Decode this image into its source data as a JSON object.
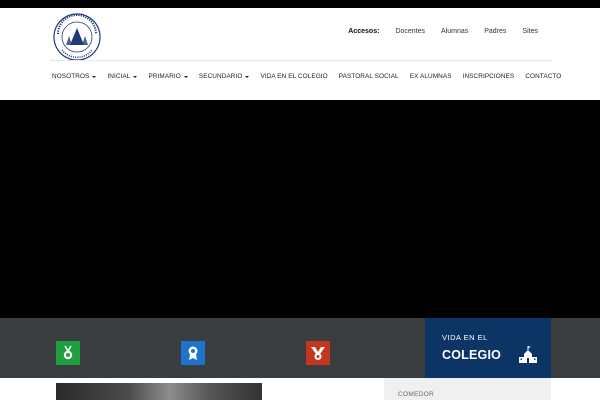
{
  "logo": {
    "text_top": "COLEGIO SAN MARTÍN DE TOURS",
    "text_bottom": "MUJERES",
    "color": "#1f3a7a"
  },
  "access": {
    "label": "Accesos:",
    "links": [
      "Docentes",
      "Alumnas",
      "Padres",
      "Sites"
    ]
  },
  "nav": {
    "items": [
      {
        "label": "NOSOTROS",
        "dropdown": true
      },
      {
        "label": "INICIAL",
        "dropdown": true
      },
      {
        "label": "PRIMARIO",
        "dropdown": true
      },
      {
        "label": "SECUNDARIO",
        "dropdown": true
      },
      {
        "label": "VIDA EN EL COLEGIO",
        "dropdown": false
      },
      {
        "label": "PASTORAL SOCIAL",
        "dropdown": false
      },
      {
        "label": "EX ALUMNAS",
        "dropdown": false
      },
      {
        "label": "INSCRIPCIONES",
        "dropdown": false
      },
      {
        "label": "CONTACTO",
        "dropdown": false
      }
    ]
  },
  "features": {
    "icons": [
      {
        "name": "medal-icon",
        "color": "#1fa040"
      },
      {
        "name": "award-icon",
        "color": "#1d73c9"
      },
      {
        "name": "ribbon-icon",
        "color": "#c3361f"
      }
    ],
    "bar_color": "#3a3d40"
  },
  "vida": {
    "line1": "VIDA EN EL",
    "line2": "COLEGIO",
    "color": "#0c3566"
  },
  "sidebar": {
    "first_item": "COMEDOR"
  }
}
